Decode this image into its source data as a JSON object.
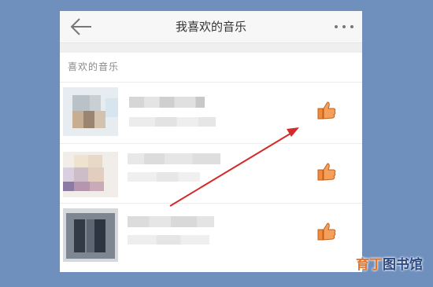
{
  "header": {
    "title": "我喜欢的音乐",
    "back_icon": "arrow-left-icon",
    "more_icon": "more-dots-icon"
  },
  "section": {
    "label": "喜欢的音乐"
  },
  "songs": [
    {
      "title": "",
      "subtitle": "",
      "like_icon": "thumbs-up-icon"
    },
    {
      "title": "",
      "subtitle": "",
      "like_icon": "thumbs-up-icon"
    },
    {
      "title": "",
      "subtitle": "",
      "like_icon": "thumbs-up-icon"
    }
  ],
  "watermark": {
    "part1": "育丁",
    "part2": "图书馆"
  },
  "colors": {
    "background": "#6f8fbd",
    "like_orange": "#f08a3c",
    "arrow_red": "#d42a2a"
  }
}
